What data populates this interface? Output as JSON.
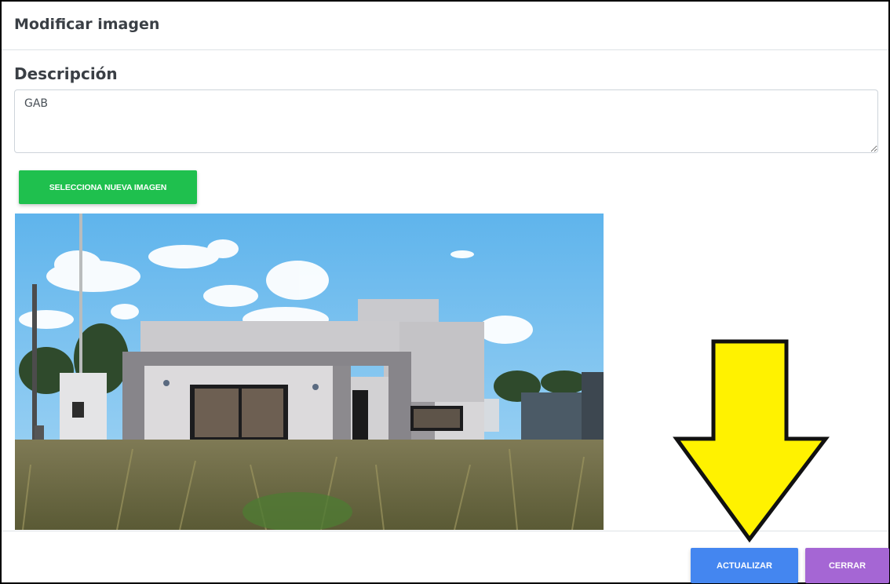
{
  "modal": {
    "title": "Modificar imagen"
  },
  "form": {
    "description_label": "Descripción",
    "description_value": "GAB",
    "select_image_label": "SELECCIONA NUEVA IMAGEN"
  },
  "footer": {
    "update_label": "ACTUALIZAR",
    "close_label": "CERRAR"
  },
  "colors": {
    "select_button": "#1fc04e",
    "update_button": "#4486f0",
    "close_button": "#a566d4",
    "arrow": "#fff200"
  },
  "icons": {
    "annotation": "down-arrow-icon"
  }
}
